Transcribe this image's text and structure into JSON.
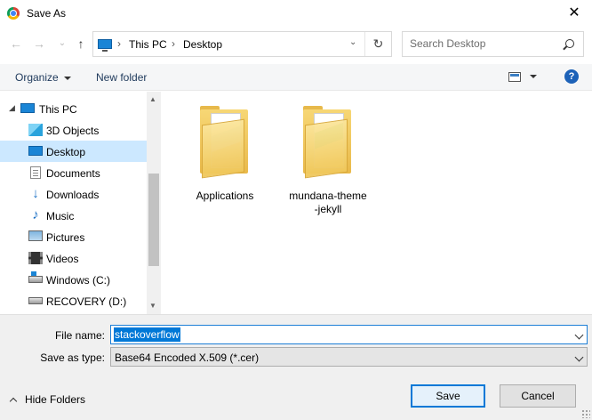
{
  "window": {
    "title": "Save As",
    "close_glyph": "✕"
  },
  "nav": {
    "back_glyph": "←",
    "forward_glyph": "→",
    "recent_glyph": "⌄",
    "up_glyph": "↑"
  },
  "address": {
    "crumbs": [
      "This PC",
      "Desktop"
    ],
    "separator": "›",
    "refresh_glyph": "↻"
  },
  "search": {
    "placeholder": "Search Desktop"
  },
  "toolbar": {
    "organize_label": "Organize",
    "new_folder_label": "New folder",
    "help_label": "?"
  },
  "sidebar": {
    "items": [
      {
        "label": "This PC",
        "icon": "this-pc-icon"
      },
      {
        "label": "3D Objects",
        "icon": "3d-objects-icon"
      },
      {
        "label": "Desktop",
        "icon": "desktop-icon",
        "selected": true
      },
      {
        "label": "Documents",
        "icon": "documents-icon"
      },
      {
        "label": "Downloads",
        "icon": "downloads-icon"
      },
      {
        "label": "Music",
        "icon": "music-icon"
      },
      {
        "label": "Pictures",
        "icon": "pictures-icon"
      },
      {
        "label": "Videos",
        "icon": "videos-icon"
      },
      {
        "label": "Windows (C:)",
        "icon": "windows-drive-icon"
      },
      {
        "label": "RECOVERY (D:)",
        "icon": "recovery-drive-icon"
      }
    ],
    "expand_glyph": "▸",
    "scroll_up_glyph": "▲",
    "scroll_down_glyph": "▼"
  },
  "content": {
    "folders": [
      {
        "name": "Applications",
        "icon": "folder-icon"
      },
      {
        "name_line1": "mundana-theme",
        "name_line2": "-jekyll",
        "icon": "folder-icon"
      }
    ]
  },
  "form": {
    "file_name_label": "File name:",
    "file_name_value": "stackoverflow",
    "save_type_label": "Save as type:",
    "save_type_value": "Base64 Encoded X.509 (*.cer)"
  },
  "footer": {
    "hide_folders_label": "Hide Folders",
    "save_label": "Save",
    "cancel_label": "Cancel"
  },
  "colors": {
    "accent": "#0078d7",
    "selection": "#cce8ff",
    "help": "#1d62b8"
  }
}
